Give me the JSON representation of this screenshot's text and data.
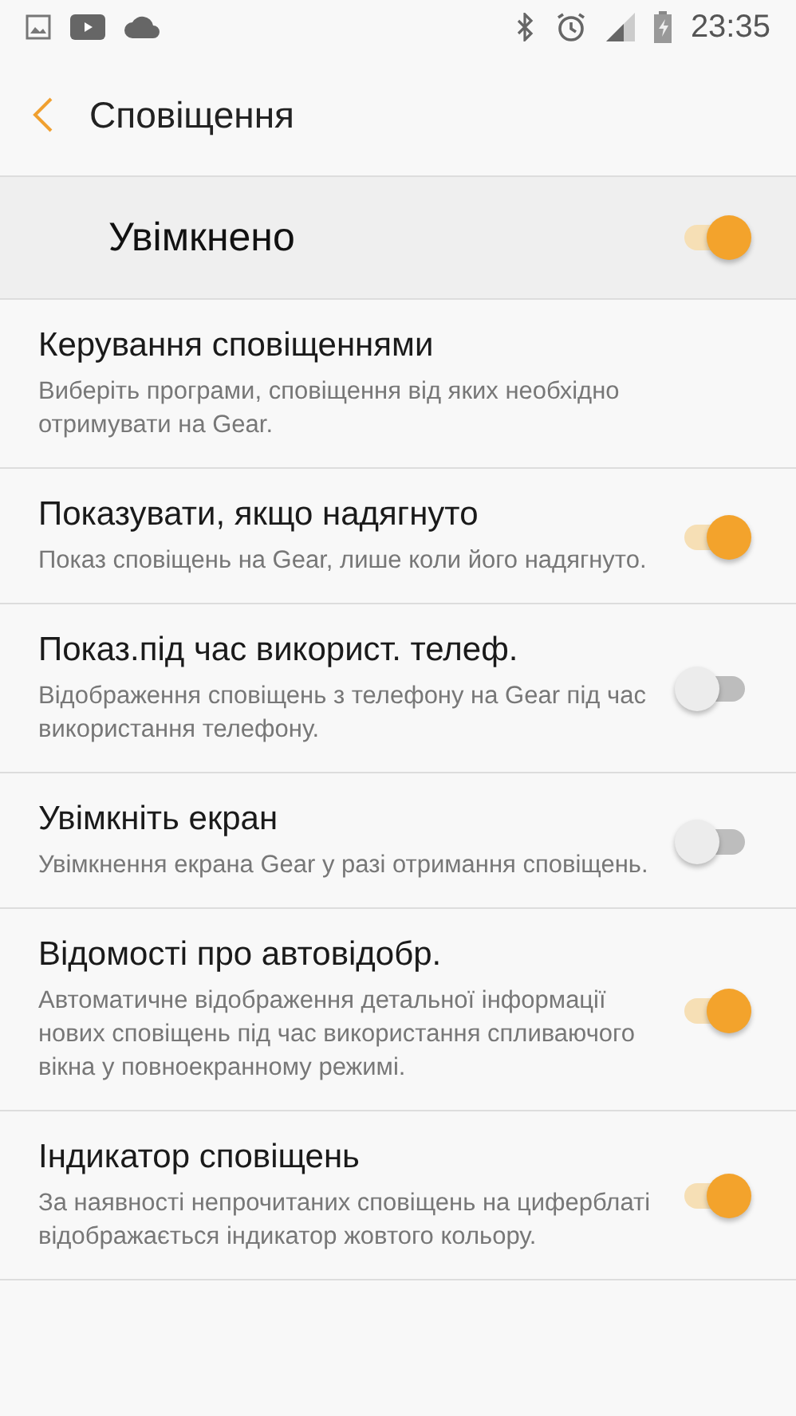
{
  "status_bar": {
    "time": "23:35"
  },
  "header": {
    "title": "Сповіщення"
  },
  "master": {
    "label": "Увімкнено",
    "on": true
  },
  "settings": [
    {
      "kind": "link",
      "title": "Керування сповіщеннями",
      "description": "Виберіть програми, сповіщення від яких необхідно отримувати на Gear."
    },
    {
      "kind": "switch",
      "title": "Показувати, якщо надягнуто",
      "description": "Показ сповіщень на Gear, лише коли його надягнуто.",
      "on": true
    },
    {
      "kind": "switch",
      "title": "Показ.під час використ. телеф.",
      "description": "Відображення сповіщень з телефону на Gear під час використання телефону.",
      "on": false
    },
    {
      "kind": "switch",
      "title": "Увімкніть екран",
      "description": "Увімкнення екрана Gear у разі отримання сповіщень.",
      "on": false
    },
    {
      "kind": "switch",
      "title": "Відомості про автовідобр.",
      "description": "Автоматичне відображення детальної інформації нових сповіщень під час використання спливаючого вікна у повноекранному режимі.",
      "on": true
    },
    {
      "kind": "switch",
      "title": "Індикатор сповіщень",
      "description": "За наявності непрочитаних сповіщень на циферблаті відображається індикатор жовтого кольору.",
      "on": true
    }
  ]
}
